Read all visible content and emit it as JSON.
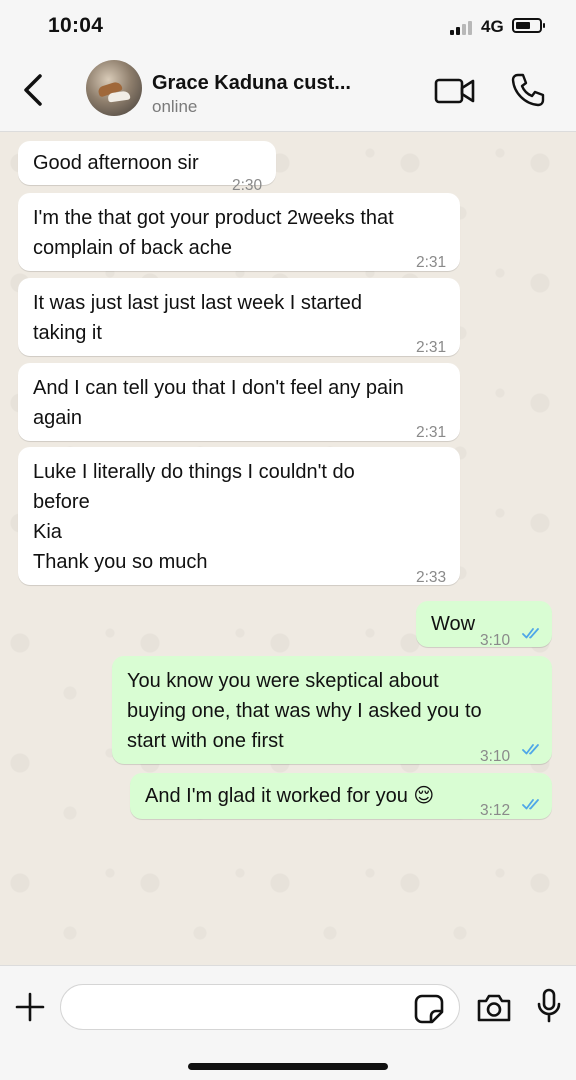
{
  "status_bar": {
    "time": "10:04",
    "network": "4G"
  },
  "header": {
    "back_icon": "chevron-left-icon",
    "contact_name": "Grace Kaduna cust...",
    "contact_status": "online",
    "video_icon": "video-camera-icon",
    "call_icon": "phone-icon"
  },
  "messages": [
    {
      "direction": "in",
      "text": "Good afternoon sir",
      "time": "2:30"
    },
    {
      "direction": "in",
      "text": "I'm the that got your product 2weeks that\ncomplain of back ache",
      "time": "2:31"
    },
    {
      "direction": "in",
      "text": "It was just last just last week I started\ntaking it",
      "time": "2:31"
    },
    {
      "direction": "in",
      "text": "And I can tell you that I don't feel any pain\nagain",
      "time": "2:31"
    },
    {
      "direction": "in",
      "text": "Luke I literally do things I couldn't do\nbefore\nKia\nThank you so much",
      "time": "2:33"
    },
    {
      "direction": "out",
      "text": "Wow",
      "time": "3:10",
      "status": "read"
    },
    {
      "direction": "out",
      "text": "You know you were skeptical about\nbuying one, that was why I asked you to\nstart with one first",
      "time": "3:10",
      "status": "read"
    },
    {
      "direction": "out",
      "text": "And I'm glad it worked for you 😌",
      "time": "3:12",
      "status": "read"
    }
  ],
  "input_bar": {
    "message_value": "",
    "plus_icon": "plus-icon",
    "sticker_icon": "sticker-icon",
    "camera_icon": "camera-icon",
    "mic_icon": "microphone-icon"
  },
  "colors": {
    "incoming_bubble": "#ffffff",
    "outgoing_bubble": "#d9fdd3",
    "chat_background": "#efeae2",
    "read_ticks": "#4fa6e8"
  }
}
